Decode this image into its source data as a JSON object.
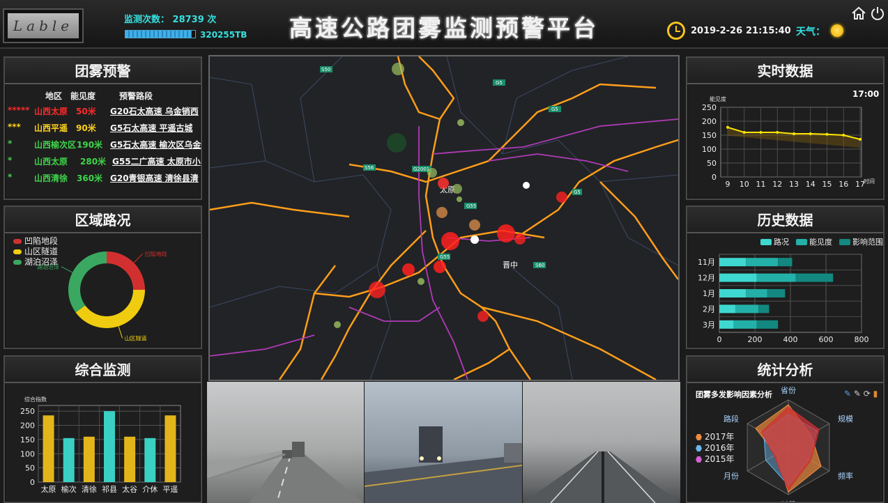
{
  "header": {
    "logo_text": "Lable",
    "monitor_count_label": "监测次数：",
    "monitor_count_value": "28739",
    "monitor_count_unit": "次",
    "storage_value": "320255TB",
    "storage_progress_fraction": 0.95,
    "title": "高速公路团雾监测预警平台",
    "date": "2019-2-26",
    "time": "21:15:40",
    "weather_label": "天气：",
    "weather_icon": "sun-icon"
  },
  "fog_warning": {
    "title": "团雾预警",
    "columns": [
      "地区",
      "能见度",
      "预警路段"
    ],
    "rows": [
      {
        "level": "*****",
        "region": "山西太原",
        "visibility": "50米",
        "route": "G20石太高速 乌金销西",
        "color": "#ff2a2a"
      },
      {
        "level": "***",
        "region": "山西平遥",
        "visibility": "90米",
        "route": "G5石太高速 平遥古城",
        "color": "#ffd21c"
      },
      {
        "level": "*",
        "region": "山西榆次区",
        "visibility": "190米",
        "route": "G5石太高速 榆次区乌金",
        "color": "#3fd44a"
      },
      {
        "level": "*",
        "region": "山西太原",
        "visibility": "280米",
        "route": "G55二广高速 太原市小",
        "color": "#3fd44a"
      },
      {
        "level": "*",
        "region": "山西清徐",
        "visibility": "360米",
        "route": "G20青银高速 清徐县清",
        "color": "#3fd44a"
      }
    ]
  },
  "road_status": {
    "title": "区域路况",
    "legend": [
      {
        "label": "凹陷地段",
        "color": "#d23030"
      },
      {
        "label": "山区隧道",
        "color": "#f0cc10"
      },
      {
        "label": "湖泊沼泽",
        "color": "#3aa860"
      }
    ],
    "donut": [
      {
        "label": "凹陷地段",
        "fraction": 0.25,
        "color": "#d23030"
      },
      {
        "label": "山区隧道",
        "fraction": 0.4,
        "color": "#f0cc10"
      },
      {
        "label": "湖泊沼泽",
        "fraction": 0.35,
        "color": "#3aa860"
      }
    ]
  },
  "comprehensive": {
    "title": "综合监测",
    "axis_label": "综合指数",
    "yticks": [
      "250",
      "200",
      "150",
      "100",
      "50",
      "0"
    ]
  },
  "realtime": {
    "title": "实时数据",
    "ylabel": "能见度",
    "xlabel": "时间",
    "current_time": "17:00",
    "yticks": [
      "250",
      "200",
      "150",
      "100",
      "50",
      "0"
    ]
  },
  "history": {
    "title": "历史数据",
    "legend": [
      {
        "label": "路况",
        "color": "#3fd8d0"
      },
      {
        "label": "能见度",
        "color": "#23b0a8"
      },
      {
        "label": "影响范围",
        "color": "#128880"
      }
    ],
    "xticks": [
      "0",
      "200",
      "400",
      "600",
      "800"
    ]
  },
  "stats": {
    "title": "统计分析",
    "chart_title": "团雾多发影响因素分析",
    "axes": [
      "省份",
      "规模",
      "频率",
      "时段",
      "月份",
      "路段"
    ],
    "legend": [
      {
        "label": "2017年",
        "color": "#f08a3c"
      },
      {
        "label": "2016年",
        "color": "#68b8f0"
      },
      {
        "label": "2015年",
        "color": "#d060d0"
      }
    ]
  },
  "chart_data": [
    {
      "type": "bar",
      "title": "综合监测",
      "ylabel": "综合指数",
      "categories": [
        "太原",
        "榆次",
        "清徐",
        "祁县",
        "太谷",
        "介休",
        "平遥"
      ],
      "values": [
        235,
        155,
        160,
        250,
        160,
        155,
        235
      ],
      "colors": [
        "#e3b51b",
        "#3ad0c4",
        "#e3b51b",
        "#3ad0c4",
        "#e3b51b",
        "#3ad0c4",
        "#e3b51b"
      ],
      "ylim": [
        0,
        270
      ],
      "grid": true
    },
    {
      "type": "line",
      "title": "实时数据",
      "ylabel": "能见度",
      "xlabel": "时间",
      "x": [
        9,
        10,
        11,
        12,
        13,
        14,
        15,
        16,
        17
      ],
      "series": [
        {
          "values": [
            178,
            160,
            160,
            160,
            155,
            155,
            153,
            150,
            135
          ],
          "color": "#ffe600"
        }
      ],
      "ylim": [
        0,
        250
      ],
      "grid": true
    },
    {
      "type": "bar",
      "orientation": "horizontal",
      "stacked": true,
      "title": "历史数据",
      "categories": [
        "11月",
        "12月",
        "1月",
        "2月",
        "3月"
      ],
      "series": [
        {
          "name": "路况",
          "values": [
            150,
            210,
            150,
            90,
            80
          ]
        },
        {
          "name": "能见度",
          "values": [
            180,
            220,
            120,
            130,
            130
          ]
        },
        {
          "name": "影响范围",
          "values": [
            80,
            210,
            100,
            60,
            120
          ]
        }
      ],
      "xlim": [
        0,
        800
      ],
      "grid": true,
      "legend_position": "top-right"
    },
    {
      "type": "radar",
      "title": "团雾多发影响因素分析",
      "axes": [
        "省份",
        "规模",
        "频率",
        "时段",
        "月份",
        "路段"
      ],
      "series": [
        {
          "name": "2017年",
          "values": [
            0.9,
            0.55,
            0.8,
            0.95,
            0.3,
            0.8
          ]
        },
        {
          "name": "2016年",
          "values": [
            0.7,
            0.7,
            0.5,
            0.8,
            0.55,
            0.6
          ]
        },
        {
          "name": "2015年",
          "values": [
            0.85,
            0.75,
            0.55,
            0.9,
            0.35,
            0.65
          ]
        }
      ],
      "legend_position": "left"
    }
  ],
  "map": {
    "city_labels": [
      "太原",
      "晋中"
    ],
    "road_labels": [
      "G5",
      "G55",
      "G20",
      "S50",
      "S56",
      "S60",
      "G2001",
      "G5"
    ]
  },
  "photos": [
    {
      "name": "fog-highway-photo-1"
    },
    {
      "name": "fog-highway-photo-2"
    },
    {
      "name": "fog-highway-photo-3"
    }
  ]
}
